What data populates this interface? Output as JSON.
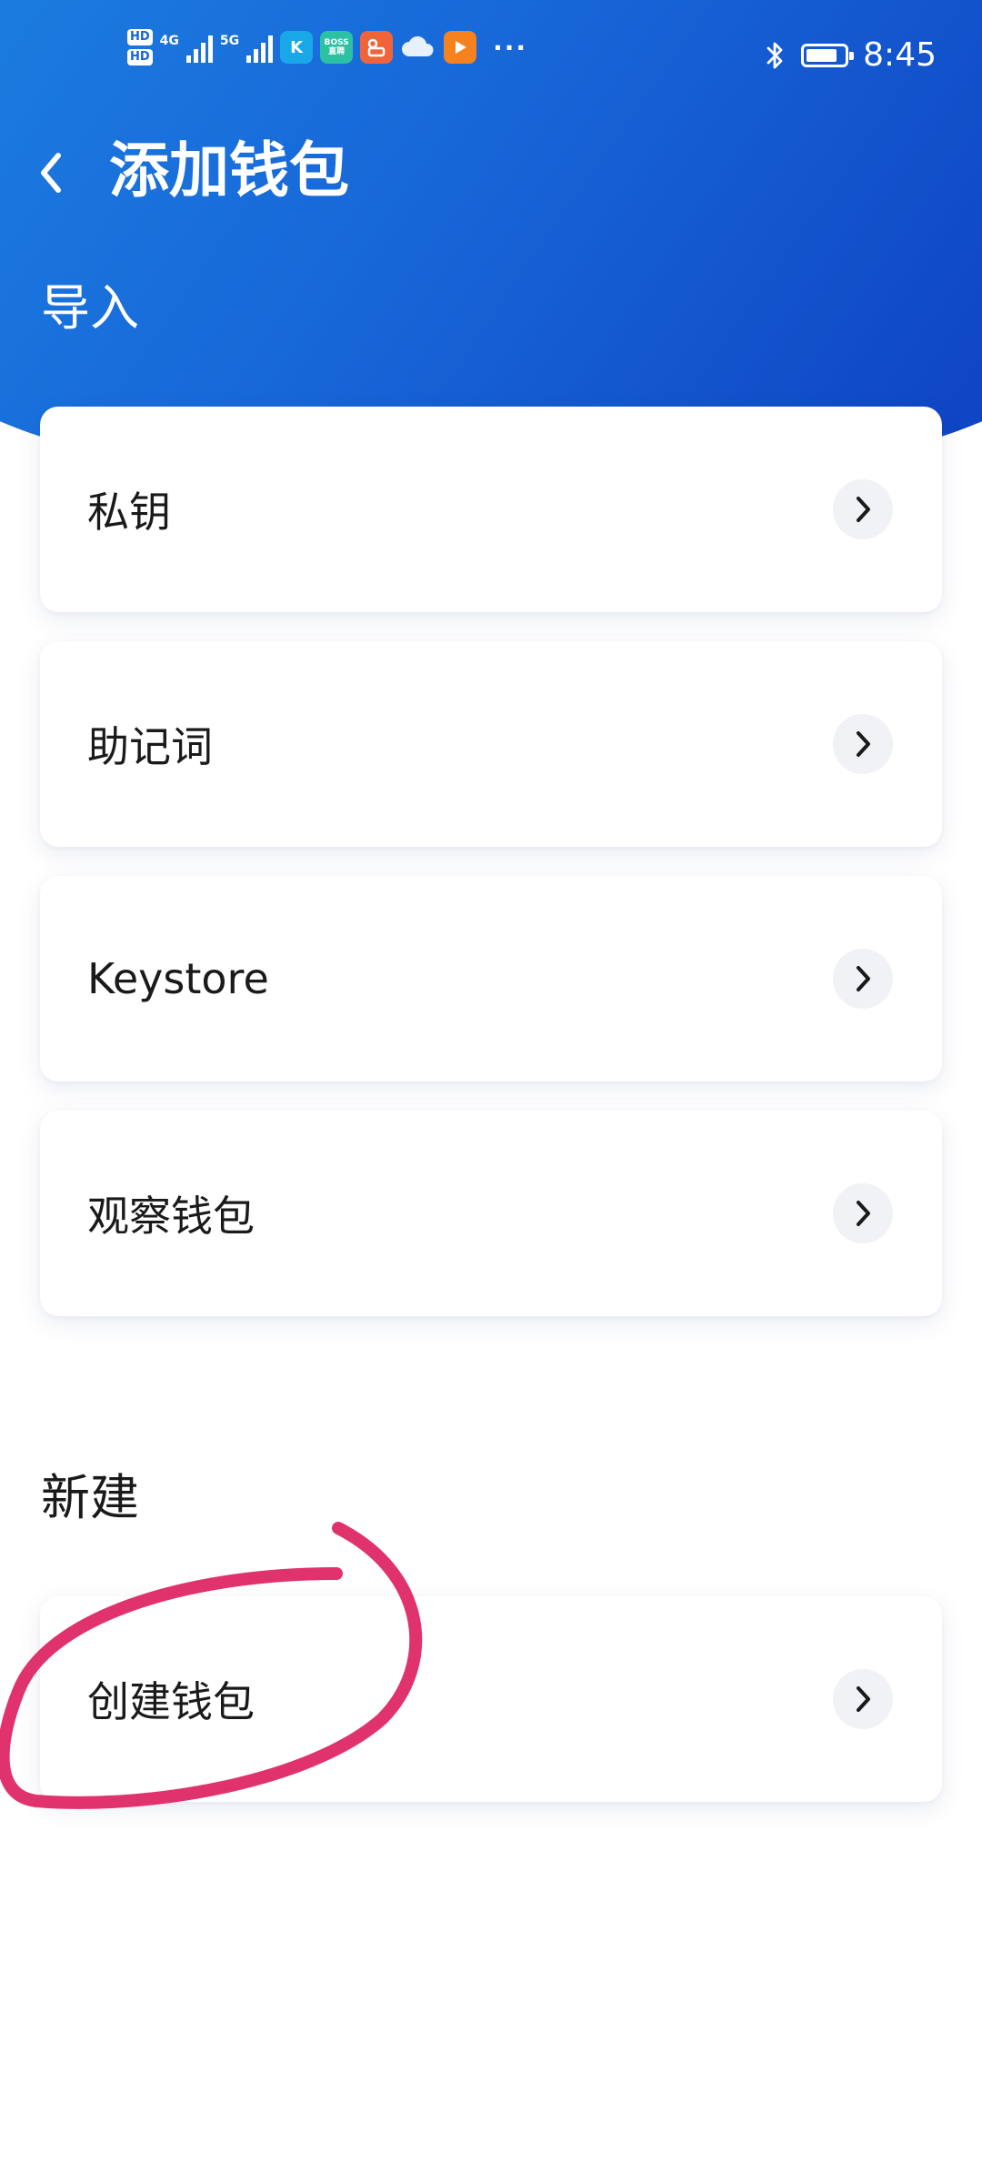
{
  "status_bar": {
    "hd1": "HD",
    "hd2": "HD",
    "net1": "4G",
    "net2": "5G",
    "app_k": "K",
    "app_boss": "BOSS\n直聘",
    "more": "···",
    "time": "8:45",
    "battery_level": 0.85
  },
  "header": {
    "title": "添加钱包"
  },
  "sections": {
    "import": {
      "title": "导入",
      "items": [
        {
          "label": "私钥"
        },
        {
          "label": "助记词"
        },
        {
          "label": "Keystore"
        },
        {
          "label": "观察钱包"
        }
      ]
    },
    "create": {
      "title": "新建",
      "items": [
        {
          "label": "创建钱包"
        }
      ]
    }
  },
  "colors": {
    "header_gradient_start": "#1c7fe0",
    "header_gradient_end": "#0e3fc0",
    "annotation": "#e0336e",
    "text": "#1a1a1a"
  }
}
